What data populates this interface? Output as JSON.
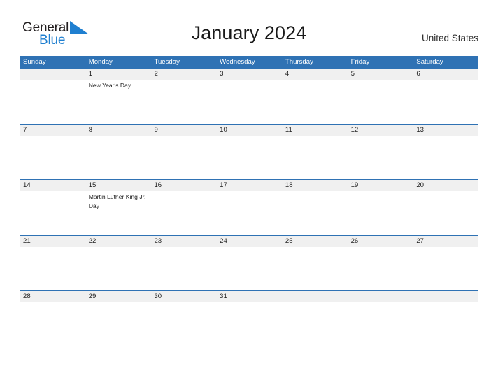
{
  "logo": {
    "word_one": "General",
    "word_two": "Blue",
    "triangle_icon": "blue-triangle-icon",
    "dark_color": "#231f20",
    "blue_color": "#1f7fd0"
  },
  "header": {
    "title": "January 2024",
    "region": "United States"
  },
  "colors": {
    "header_blue": "#2f72b4",
    "daynum_band_gray": "#f0f0f0",
    "page_background": "#ffffff",
    "text_dark": "#1c1c1c"
  },
  "calendar": {
    "month": "January",
    "year": "2024",
    "weekday_headers": [
      "Sunday",
      "Monday",
      "Tuesday",
      "Wednesday",
      "Thursday",
      "Friday",
      "Saturday"
    ],
    "weeks": [
      {
        "days": [
          {
            "num": "",
            "event": ""
          },
          {
            "num": "1",
            "event": "New Year's Day"
          },
          {
            "num": "2",
            "event": ""
          },
          {
            "num": "3",
            "event": ""
          },
          {
            "num": "4",
            "event": ""
          },
          {
            "num": "5",
            "event": ""
          },
          {
            "num": "6",
            "event": ""
          }
        ]
      },
      {
        "days": [
          {
            "num": "7",
            "event": ""
          },
          {
            "num": "8",
            "event": ""
          },
          {
            "num": "9",
            "event": ""
          },
          {
            "num": "10",
            "event": ""
          },
          {
            "num": "11",
            "event": ""
          },
          {
            "num": "12",
            "event": ""
          },
          {
            "num": "13",
            "event": ""
          }
        ]
      },
      {
        "days": [
          {
            "num": "14",
            "event": ""
          },
          {
            "num": "15",
            "event": "Martin Luther King Jr. Day"
          },
          {
            "num": "16",
            "event": ""
          },
          {
            "num": "17",
            "event": ""
          },
          {
            "num": "18",
            "event": ""
          },
          {
            "num": "19",
            "event": ""
          },
          {
            "num": "20",
            "event": ""
          }
        ]
      },
      {
        "days": [
          {
            "num": "21",
            "event": ""
          },
          {
            "num": "22",
            "event": ""
          },
          {
            "num": "23",
            "event": ""
          },
          {
            "num": "24",
            "event": ""
          },
          {
            "num": "25",
            "event": ""
          },
          {
            "num": "26",
            "event": ""
          },
          {
            "num": "27",
            "event": ""
          }
        ]
      },
      {
        "days": [
          {
            "num": "28",
            "event": ""
          },
          {
            "num": "29",
            "event": ""
          },
          {
            "num": "30",
            "event": ""
          },
          {
            "num": "31",
            "event": ""
          },
          {
            "num": "",
            "event": ""
          },
          {
            "num": "",
            "event": ""
          },
          {
            "num": "",
            "event": ""
          }
        ]
      }
    ]
  }
}
